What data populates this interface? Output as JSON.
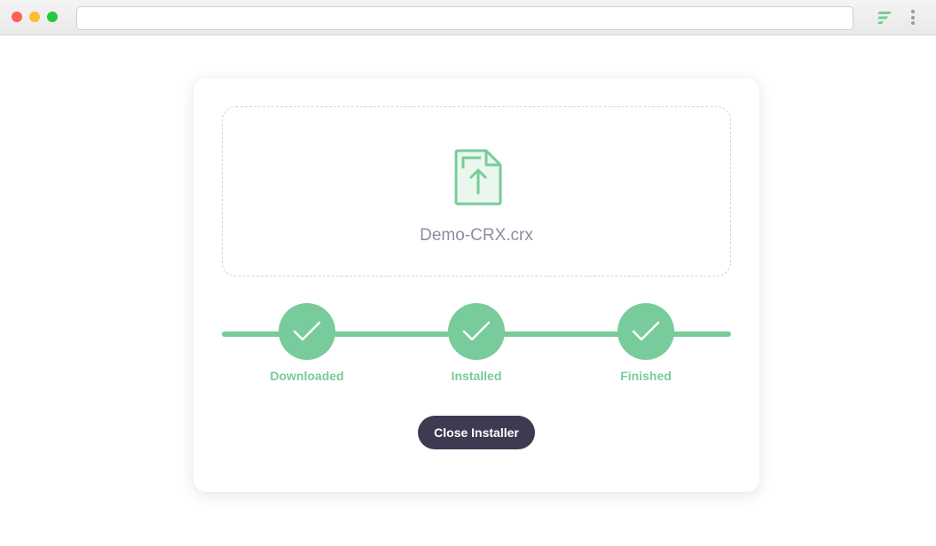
{
  "browser": {
    "address_value": "",
    "extension_icon": "stacked-bars-icon",
    "menu_icon": "vertical-dots-icon"
  },
  "dropzone": {
    "icon": "file-upload-icon",
    "file_name": "Demo-CRX.crx"
  },
  "steps": [
    {
      "label": "Downloaded",
      "icon": "check-icon",
      "complete": true
    },
    {
      "label": "Installed",
      "icon": "check-icon",
      "complete": true
    },
    {
      "label": "Finished",
      "icon": "check-icon",
      "complete": true
    }
  ],
  "actions": {
    "close_label": "Close Installer"
  },
  "colors": {
    "accent_green": "#78cb9a",
    "button_dark": "#3d3a52",
    "file_text": "#8a8f9c"
  }
}
